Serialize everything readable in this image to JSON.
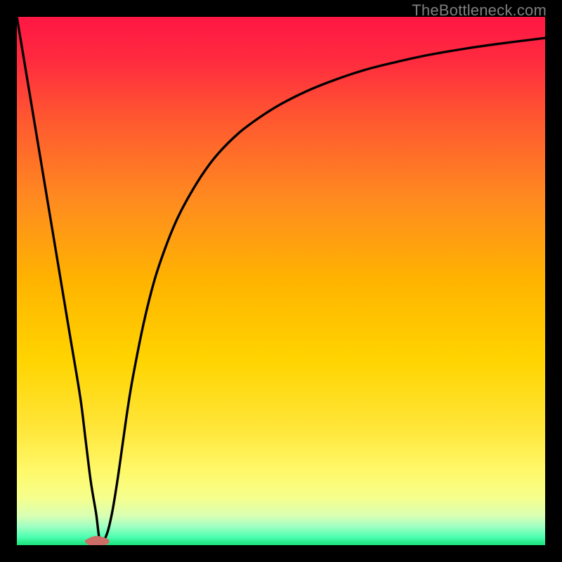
{
  "watermark": {
    "text": "TheBottleneck.com"
  },
  "colors": {
    "frame": "#000000",
    "curve": "#000000",
    "marker_fill": "#cc6e66",
    "marker_stroke": "#cc6e66",
    "gradient_stops": [
      {
        "offset": 0.0,
        "color": "#ff1744"
      },
      {
        "offset": 0.08,
        "color": "#ff2a3f"
      },
      {
        "offset": 0.2,
        "color": "#ff5a2f"
      },
      {
        "offset": 0.35,
        "color": "#ff8c1f"
      },
      {
        "offset": 0.5,
        "color": "#ffb400"
      },
      {
        "offset": 0.65,
        "color": "#ffd400"
      },
      {
        "offset": 0.78,
        "color": "#ffe63a"
      },
      {
        "offset": 0.86,
        "color": "#fff96a"
      },
      {
        "offset": 0.91,
        "color": "#f6ff8c"
      },
      {
        "offset": 0.945,
        "color": "#d8ffb4"
      },
      {
        "offset": 0.965,
        "color": "#9dffc2"
      },
      {
        "offset": 0.985,
        "color": "#4bffb0"
      },
      {
        "offset": 1.0,
        "color": "#18e07a"
      }
    ]
  },
  "chart_data": {
    "type": "line",
    "title": "",
    "xlabel": "",
    "ylabel": "",
    "xlim": [
      0,
      100
    ],
    "ylim": [
      0,
      100
    ],
    "series": [
      {
        "name": "bottleneck-curve",
        "x": [
          0,
          2,
          4,
          6,
          8,
          10,
          12,
          13,
          14,
          15,
          15.8,
          17,
          18,
          19,
          20,
          21,
          22,
          24,
          26,
          28,
          30,
          32,
          35,
          38,
          42,
          46,
          50,
          55,
          60,
          66,
          72,
          78,
          85,
          92,
          100
        ],
        "y": [
          100,
          88,
          76,
          64,
          52,
          40,
          28,
          20,
          12,
          6,
          0.5,
          2,
          6,
          12,
          19,
          26,
          32,
          42,
          50,
          56,
          61,
          65,
          70,
          74,
          78,
          81,
          83.5,
          86,
          88,
          90,
          91.5,
          92.8,
          94,
          95,
          96
        ]
      }
    ],
    "marker": {
      "name": "optimal-point",
      "shape": "bean",
      "x": 15.2,
      "y": 0.8,
      "width_x": 4.5,
      "height_y": 1.8
    }
  }
}
